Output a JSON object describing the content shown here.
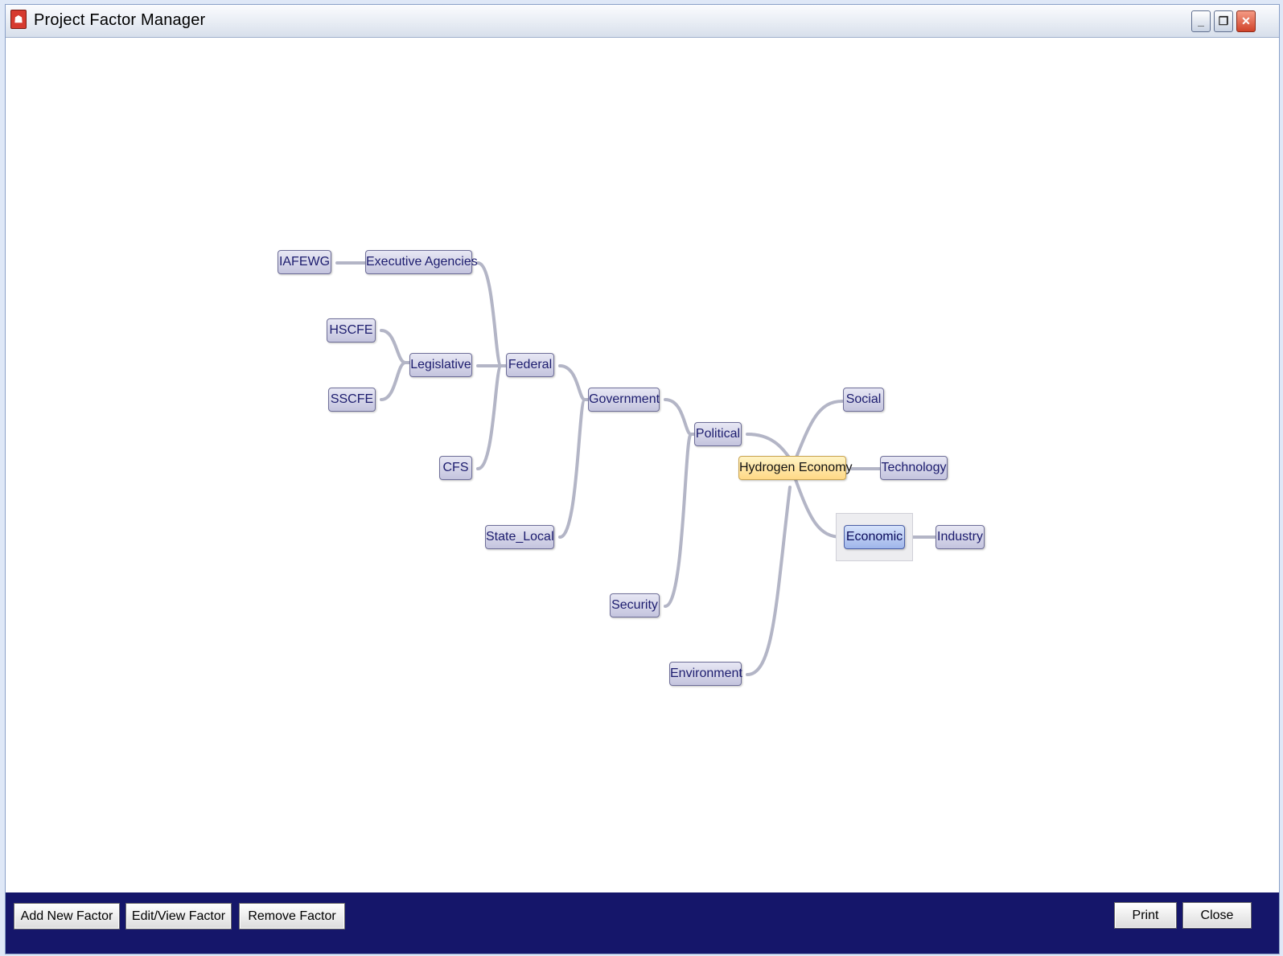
{
  "window": {
    "title": "Project Factor Manager",
    "app_icon_glyph": "☗",
    "minimize_glyph": "_",
    "restore_glyph": "❐",
    "close_glyph": "✕"
  },
  "mindmap": {
    "nodes": {
      "iafewg": "IAFEWG",
      "executive_agencies": "Executive Agencies",
      "hscfe": "HSCFE",
      "legislative": "Legislative",
      "sscfe": "SSCFE",
      "federal": "Federal",
      "cfs": "CFS",
      "government": "Government",
      "state_local": "State_Local",
      "political": "Political",
      "security": "Security",
      "hydrogen_economy": "Hydrogen Economy",
      "social": "Social",
      "technology": "Technology",
      "economic": "Economic",
      "industry": "Industry",
      "environment": "Environment"
    },
    "root_node": "Hydrogen Economy",
    "selected_node": "Economic"
  },
  "toolbar": {
    "add_new_factor": "Add New Factor",
    "edit_view_factor": "Edit/View Factor",
    "remove_factor": "Remove Factor",
    "print": "Print",
    "close": "Close"
  },
  "colors": {
    "bottom_bar": "#15166a",
    "root_node": "#ffe29a",
    "node": "#d4d4ea",
    "connector": "#b3b5c6"
  }
}
